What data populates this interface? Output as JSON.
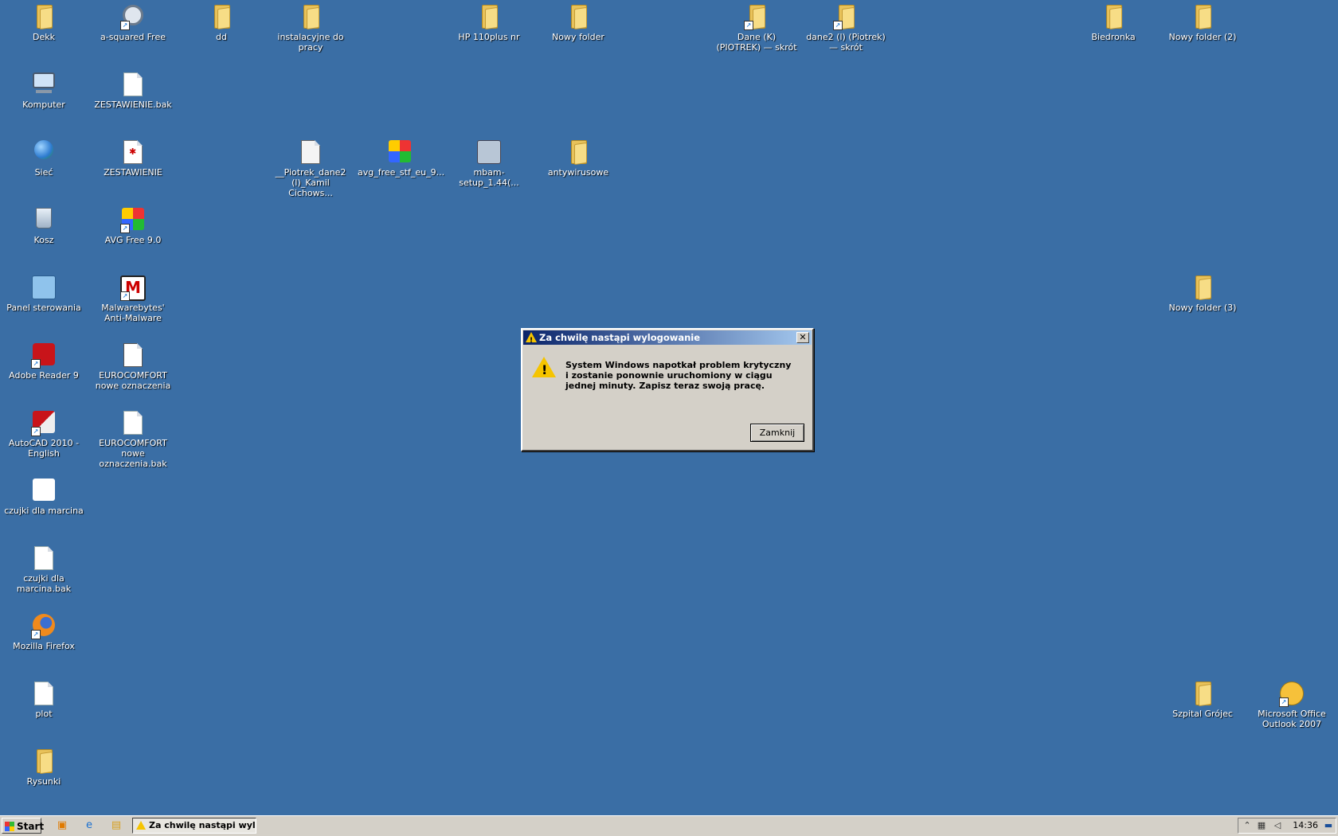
{
  "desktop": {
    "icons": [
      {
        "label": "Dekk"
      },
      {
        "label": "a-squared Free"
      },
      {
        "label": "dd"
      },
      {
        "label": "instalacyjne do pracy"
      },
      {
        "label": "HP 110plus nr"
      },
      {
        "label": "Nowy folder"
      },
      {
        "label": "Dane (K) (PIOTREK) — skrót"
      },
      {
        "label": "dane2 (l) (Piotrek) — skrót"
      },
      {
        "label": "Biedronka"
      },
      {
        "label": "Nowy folder (2)"
      },
      {
        "label": "Komputer"
      },
      {
        "label": "ZESTAWIENIE.bak"
      },
      {
        "label": "Sieć"
      },
      {
        "label": "ZESTAWIENIE"
      },
      {
        "label": "__Piotrek_dane2 (l)_Kamil Cichows..."
      },
      {
        "label": "avg_free_stf_eu_9..."
      },
      {
        "label": "mbam-setup_1.44(..."
      },
      {
        "label": "antywirusowe"
      },
      {
        "label": "Kosz"
      },
      {
        "label": "AVG Free 9.0"
      },
      {
        "label": "Panel sterowania"
      },
      {
        "label": "Malwarebytes' Anti-Malware"
      },
      {
        "label": "Nowy folder (3)"
      },
      {
        "label": "Adobe Reader 9"
      },
      {
        "label": "EUROCOMFORT nowe oznaczenia"
      },
      {
        "label": "AutoCAD 2010 - English"
      },
      {
        "label": "EUROCOMFORT nowe oznaczenia.bak"
      },
      {
        "label": "czujki dla marcina"
      },
      {
        "label": "czujki dla marcina.bak"
      },
      {
        "label": "Mozilla Firefox"
      },
      {
        "label": "plot"
      },
      {
        "label": "Szpital Grójec"
      },
      {
        "label": "Microsoft Office Outlook 2007"
      },
      {
        "label": "Rysunki"
      }
    ]
  },
  "dialog": {
    "title": "Za chwilę nastąpi wylogowanie",
    "message": "System Windows napotkał problem krytyczny i zostanie ponownie uruchomiony w ciągu jednej minuty. Zapisz teraz swoją pracę.",
    "button": "Zamknij",
    "close_glyph": "✕"
  },
  "taskbar": {
    "start_label": "Start",
    "task_label": "Za chwilę nastąpi wyl...",
    "clock": "14:36"
  }
}
